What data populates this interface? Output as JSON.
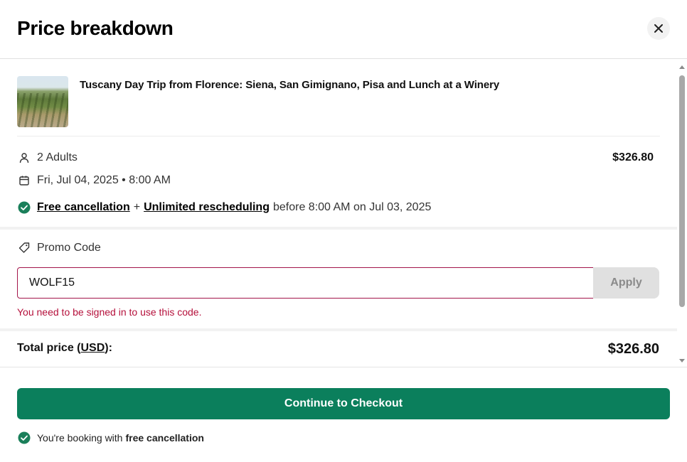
{
  "header": {
    "title": "Price breakdown",
    "close_icon": "close-icon"
  },
  "product": {
    "title": "Tuscany Day Trip from Florence: Siena, San Gimignano, Pisa and Lunch at a Winery",
    "image": "vineyard-thumbnail"
  },
  "booking": {
    "travelers": "2 Adults",
    "subtotal": "$326.80",
    "date_time": "Fri, Jul 04, 2025 • 8:00 AM",
    "free_cancellation": "Free cancellation",
    "plus": "+",
    "unlimited_rescheduling": "Unlimited rescheduling",
    "cancellation_deadline": "before 8:00 AM on Jul 03, 2025"
  },
  "promo": {
    "label": "Promo Code",
    "value": "WOLF15",
    "apply_label": "Apply",
    "error": "You need to be signed in to use this code."
  },
  "total": {
    "label": "Total price (",
    "currency": "USD",
    "label_suffix": "):",
    "value": "$326.80"
  },
  "footer": {
    "checkout_label": "Continue to Checkout",
    "note_prefix": "You're booking with",
    "note_strong": "free cancellation"
  },
  "colors": {
    "brand_green": "#0b7f5c",
    "error_red": "#b5103b",
    "check_green": "#1a7f5a"
  }
}
